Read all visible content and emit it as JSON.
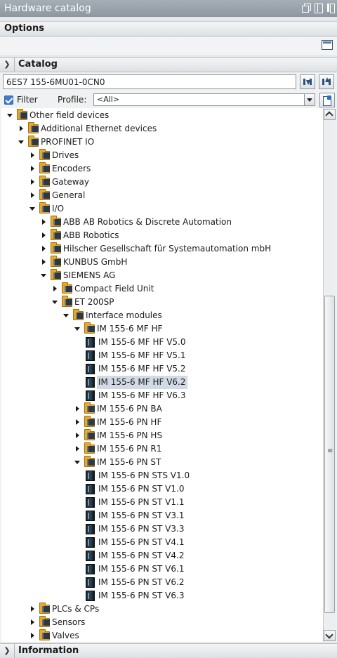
{
  "title": "Hardware catalog",
  "options": {
    "label": "Options"
  },
  "catalog": {
    "label": "Catalog",
    "search_value": "6ES7 155-6MU01-0CN0",
    "filter_label": "Filter",
    "filter_checked": true,
    "profile_label": "Profile:",
    "profile_value": "<All>"
  },
  "tree": [
    {
      "label": "Other field devices",
      "level": 0,
      "expander": "open",
      "icon": "folder-icon"
    },
    {
      "label": "Additional Ethernet devices",
      "level": 1,
      "expander": "closed",
      "icon": "folder-icon"
    },
    {
      "label": "PROFINET IO",
      "level": 1,
      "expander": "open",
      "icon": "folder-icon"
    },
    {
      "label": "Drives",
      "level": 2,
      "expander": "closed",
      "icon": "folder-icon"
    },
    {
      "label": "Encoders",
      "level": 2,
      "expander": "closed",
      "icon": "folder-icon"
    },
    {
      "label": "Gateway",
      "level": 2,
      "expander": "closed",
      "icon": "folder-icon"
    },
    {
      "label": "General",
      "level": 2,
      "expander": "closed",
      "icon": "folder-icon"
    },
    {
      "label": "I/O",
      "level": 2,
      "expander": "open",
      "icon": "folder-icon"
    },
    {
      "label": "ABB AB Robotics & Discrete Automation",
      "level": 3,
      "expander": "closed",
      "icon": "folder-icon"
    },
    {
      "label": "ABB Robotics",
      "level": 3,
      "expander": "closed",
      "icon": "folder-icon"
    },
    {
      "label": "Hilscher Gesellschaft für Systemautomation mbH",
      "level": 3,
      "expander": "closed",
      "icon": "folder-icon"
    },
    {
      "label": "KUNBUS GmbH",
      "level": 3,
      "expander": "closed",
      "icon": "folder-icon"
    },
    {
      "label": "SIEMENS AG",
      "level": 3,
      "expander": "open",
      "icon": "folder-icon"
    },
    {
      "label": "Compact Field Unit",
      "level": 4,
      "expander": "closed",
      "icon": "folder-icon"
    },
    {
      "label": "ET 200SP",
      "level": 4,
      "expander": "open",
      "icon": "folder-icon"
    },
    {
      "label": "Interface modules",
      "level": 5,
      "expander": "open",
      "icon": "folder-icon"
    },
    {
      "label": "IM 155-6 MF HF",
      "level": 6,
      "expander": "open",
      "icon": "folder-icon"
    },
    {
      "label": "IM 155-6 MF HF V5.0",
      "level": 7,
      "expander": "none",
      "icon": "module-icon"
    },
    {
      "label": "IM 155-6 MF HF V5.1",
      "level": 7,
      "expander": "none",
      "icon": "module-icon"
    },
    {
      "label": "IM 155-6 MF HF V5.2",
      "level": 7,
      "expander": "none",
      "icon": "module-icon"
    },
    {
      "label": "IM 155-6 MF HF V6.2",
      "level": 7,
      "expander": "none",
      "icon": "module-icon",
      "selected": true
    },
    {
      "label": "IM 155-6 MF HF V6.3",
      "level": 7,
      "expander": "none",
      "icon": "module-icon"
    },
    {
      "label": "IM 155-6 PN BA",
      "level": 6,
      "expander": "closed",
      "icon": "folder-icon"
    },
    {
      "label": "IM 155-6 PN HF",
      "level": 6,
      "expander": "closed",
      "icon": "folder-icon"
    },
    {
      "label": "IM 155-6 PN HS",
      "level": 6,
      "expander": "closed",
      "icon": "folder-icon"
    },
    {
      "label": "IM 155-6 PN R1",
      "level": 6,
      "expander": "closed",
      "icon": "folder-icon"
    },
    {
      "label": "IM 155-6 PN ST",
      "level": 6,
      "expander": "open",
      "icon": "folder-icon"
    },
    {
      "label": "IM 155-6 PN STS V1.0",
      "level": 7,
      "expander": "none",
      "icon": "module-icon"
    },
    {
      "label": "IM 155-6 PN ST V1.0",
      "level": 7,
      "expander": "none",
      "icon": "module-icon"
    },
    {
      "label": "IM 155-6 PN ST V1.1",
      "level": 7,
      "expander": "none",
      "icon": "module-icon"
    },
    {
      "label": "IM 155-6 PN ST V3.1",
      "level": 7,
      "expander": "none",
      "icon": "module-icon"
    },
    {
      "label": "IM 155-6 PN ST V3.3",
      "level": 7,
      "expander": "none",
      "icon": "module-icon"
    },
    {
      "label": "IM 155-6 PN ST V4.1",
      "level": 7,
      "expander": "none",
      "icon": "module-icon"
    },
    {
      "label": "IM 155-6 PN ST V4.2",
      "level": 7,
      "expander": "none",
      "icon": "module-icon"
    },
    {
      "label": "IM 155-6 PN ST V6.1",
      "level": 7,
      "expander": "none",
      "icon": "module-icon"
    },
    {
      "label": "IM 155-6 PN ST V6.2",
      "level": 7,
      "expander": "none",
      "icon": "module-icon"
    },
    {
      "label": "IM 155-6 PN ST V6.3",
      "level": 7,
      "expander": "none",
      "icon": "module-icon"
    },
    {
      "label": "PLCs & CPs",
      "level": 2,
      "expander": "closed",
      "icon": "folder-icon"
    },
    {
      "label": "Sensors",
      "level": 2,
      "expander": "closed",
      "icon": "folder-icon"
    },
    {
      "label": "Valves",
      "level": 2,
      "expander": "closed",
      "icon": "folder-icon"
    }
  ],
  "information": {
    "label": "Information"
  }
}
